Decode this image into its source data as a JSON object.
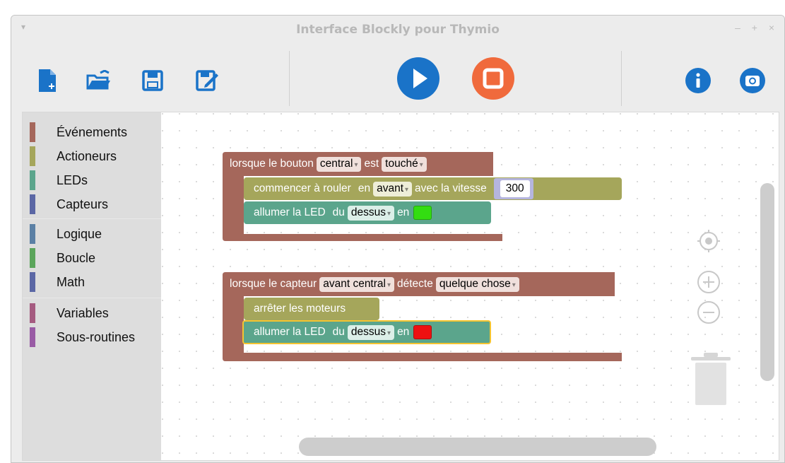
{
  "window": {
    "title": "Interface Blockly pour Thymio",
    "menu_glyph": "▾",
    "controls": "– + ×"
  },
  "toolbar": {
    "buttons": [
      {
        "icon": "new-file-icon"
      },
      {
        "icon": "open-folder-icon"
      },
      {
        "icon": "save-icon"
      },
      {
        "icon": "save-as-icon"
      },
      {
        "icon": "play-icon",
        "color": "#1a73c8"
      },
      {
        "icon": "stop-icon",
        "color": "#f06a3c"
      },
      {
        "icon": "info-icon",
        "color": "#1a73c8"
      },
      {
        "icon": "camera-icon",
        "color": "#1a73c8"
      }
    ]
  },
  "toolbox": {
    "categories": [
      {
        "label": "Événements",
        "color": "#a5675b"
      },
      {
        "label": "Actioneurs",
        "color": "#a5a65b"
      },
      {
        "label": "LEDs",
        "color": "#5ba58c"
      },
      {
        "label": "Capteurs",
        "color": "#5b67a5"
      },
      {
        "label": "Logique",
        "color": "#5b80a5"
      },
      {
        "label": "Boucle",
        "color": "#5ba55b"
      },
      {
        "label": "Math",
        "color": "#5b67a5"
      },
      {
        "label": "Variables",
        "color": "#a55b80"
      },
      {
        "label": "Sous-routines",
        "color": "#995ba5"
      }
    ]
  },
  "blocks": {
    "event1": {
      "prefix": "lorsque le bouton",
      "field1": "central",
      "mid": "est",
      "field2": "touché",
      "color": "#a5675b"
    },
    "move": {
      "prefix": "commencer à rouler",
      "en": "en",
      "dir": "avant",
      "with": "avec la vitesse",
      "speed": "300",
      "color": "#a5a65b"
    },
    "led1": {
      "prefix": "allumer la LED",
      "du": "du",
      "pos": "dessus",
      "en": "en",
      "swatch": "#33dd11",
      "color": "#5ba58c"
    },
    "event2": {
      "prefix": "lorsque le capteur",
      "field1": "avant central",
      "mid": "détecte",
      "field2": "quelque chose",
      "color": "#a5675b"
    },
    "stop": {
      "label": "arrêter les moteurs",
      "color": "#a5a65b"
    },
    "led2": {
      "prefix": "allumer la LED",
      "du": "du",
      "pos": "dessus",
      "en": "en",
      "swatch": "#ee1111",
      "color": "#5ba58c"
    },
    "dropdown_arrow": "▾"
  }
}
